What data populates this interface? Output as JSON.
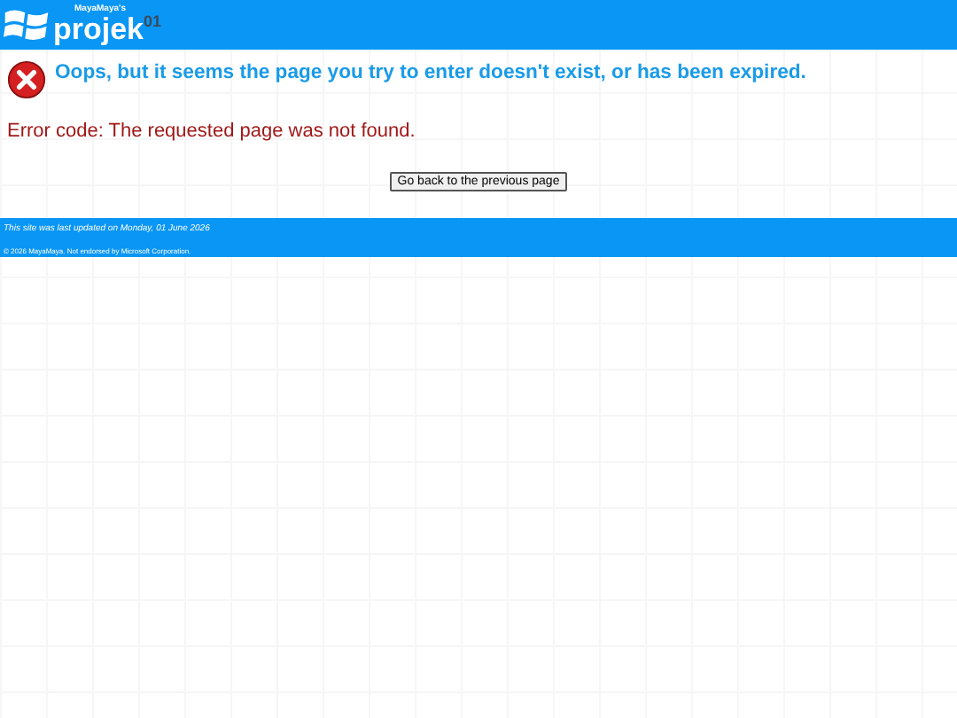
{
  "header": {
    "logo_tagline": "MayaMaya's",
    "logo_name": "projek",
    "logo_number": "01"
  },
  "error": {
    "heading": "Oops, but it seems the page you try to enter doesn't exist, or has been expired.",
    "code": "Error code: The requested page was not found.",
    "button": "Go back to the previous page"
  },
  "footer": {
    "updated": "This site was last updated on Monday, 01 June 2026",
    "copyright": "© 2026 MayaMaya. Not endorsed by Microsoft Corporation."
  }
}
